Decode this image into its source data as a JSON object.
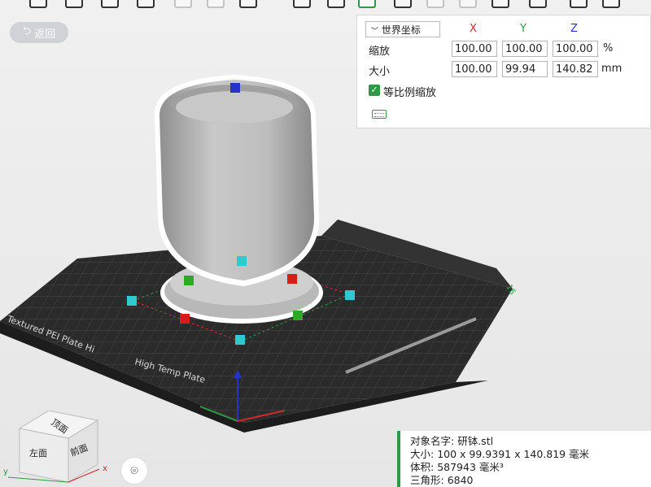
{
  "toolbar": {
    "icons": [
      "add-model-icon",
      "add-plate-icon",
      "edit-icon",
      "save-icon",
      "copy-icon",
      "paste-icon",
      "list-icon",
      "download-icon",
      "paint-icon",
      "select-box-icon",
      "sheet-icon",
      "cut-icon",
      "split-icon",
      "support-icon",
      "text-icon",
      "seam-icon",
      "layers-icon"
    ]
  },
  "back_button": {
    "label": "返回",
    "icon": "undo-icon"
  },
  "transform_panel": {
    "coordinate_system": "世界坐标",
    "axes": {
      "x": "X",
      "y": "Y",
      "z": "Z"
    },
    "axis_colors": {
      "x": "#d22a2a",
      "y": "#2f9a46",
      "z": "#2633c8"
    },
    "scale": {
      "label": "缩放",
      "x": "100.00",
      "y": "100.00",
      "z": "100.00",
      "unit": "%"
    },
    "size": {
      "label": "大小",
      "x": "100.00",
      "y": "99.94",
      "z": "140.82",
      "unit": "mm"
    },
    "uniform_scale": {
      "label": "等比例缩放",
      "checked": true
    }
  },
  "bed_text": {
    "brand_line": "Textured PEI Plate   Hi",
    "high_temp": "High Temp Plate",
    "label_15": "15"
  },
  "view_cube": {
    "top": "顶面",
    "left": "左面",
    "front": "前面",
    "axis_x": "x",
    "axis_y": "y"
  },
  "object_info": {
    "name_label": "对象名字:",
    "name_value": "研钵.stl",
    "size_label": "大小:",
    "size_value": "100 x 99.9391 x 140.819 毫米",
    "volume_label": "体积:",
    "volume_value": "587943 毫米³",
    "triangles_label": "三角形:",
    "triangles_value": "6840"
  },
  "colors": {
    "accent": "#2f9a46",
    "plate": "#2b2b2b",
    "model": "#b9b9b9"
  }
}
